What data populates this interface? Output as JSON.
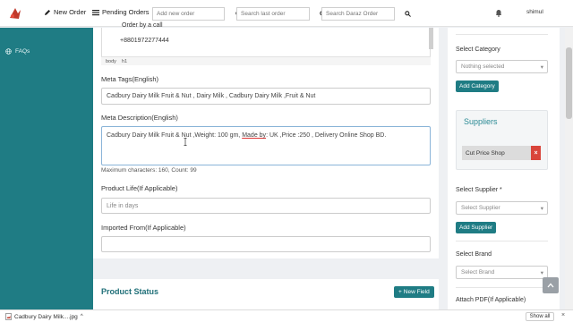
{
  "topbar": {
    "new_order": "New Order",
    "pending_orders": "Pending Orders",
    "search_new_order_placeholder": "Add new order",
    "search_last_order_placeholder": "Search last order",
    "search_daraz_placeholder": "Search Daraz Order",
    "user_name": "shimul"
  },
  "sidebar": {
    "items": [
      {
        "label": "FAQs",
        "icon": "globe-icon"
      }
    ]
  },
  "editor": {
    "line1": "Order by a call",
    "line2": "+8801972277444",
    "status_path": [
      "body",
      "h1"
    ]
  },
  "form": {
    "meta_tags_label": "Meta Tags(English)",
    "meta_tags_value": "Cadbury Dairy Milk Fruit & Nut ,  Dairy Milk , Cadbury Dairy Milk ,Fruit & Nut",
    "meta_desc_label": "Meta Description(English)",
    "meta_desc_part1": "Cadbury Dairy Milk Fruit & Nut ,Weight: 100 gm,  ",
    "meta_desc_part2": "Made  by",
    "meta_desc_part3": ": UK ,Price :250 , Delivery Online Shop BD.",
    "max_chars_hint": "Maximum characters: 160, Count: 99",
    "product_life_label": "Product Life(If Applicable)",
    "product_life_placeholder": "Life in days",
    "imported_from_label": "Imported From(If Applicable)",
    "imported_from_value": ""
  },
  "product_status": {
    "title": "Product Status",
    "new_field_button": "New Field"
  },
  "right_panel": {
    "select_category_label": "Select Category",
    "select_category_value": "Nothing selected",
    "add_category_button": "Add Category",
    "suppliers_title": "Suppliers",
    "supplier_chip": "Cut Price Shop",
    "supplier_remove": "×",
    "select_supplier_label": "Select Supplier *",
    "select_supplier_value": "Select Supplier",
    "add_supplier_button": "Add Supplier",
    "select_brand_label": "Select Brand",
    "select_brand_value": "Select Brand",
    "attach_pdf_label": "Attach PDF(If Applicable)"
  },
  "downloads": {
    "file_name": "Cadbury Dairy Milk....jpg",
    "show_all": "Show all",
    "close": "×"
  },
  "colors": {
    "sidebar": "#1f7c84",
    "accent": "#1f7c84",
    "danger": "#d9453b"
  }
}
